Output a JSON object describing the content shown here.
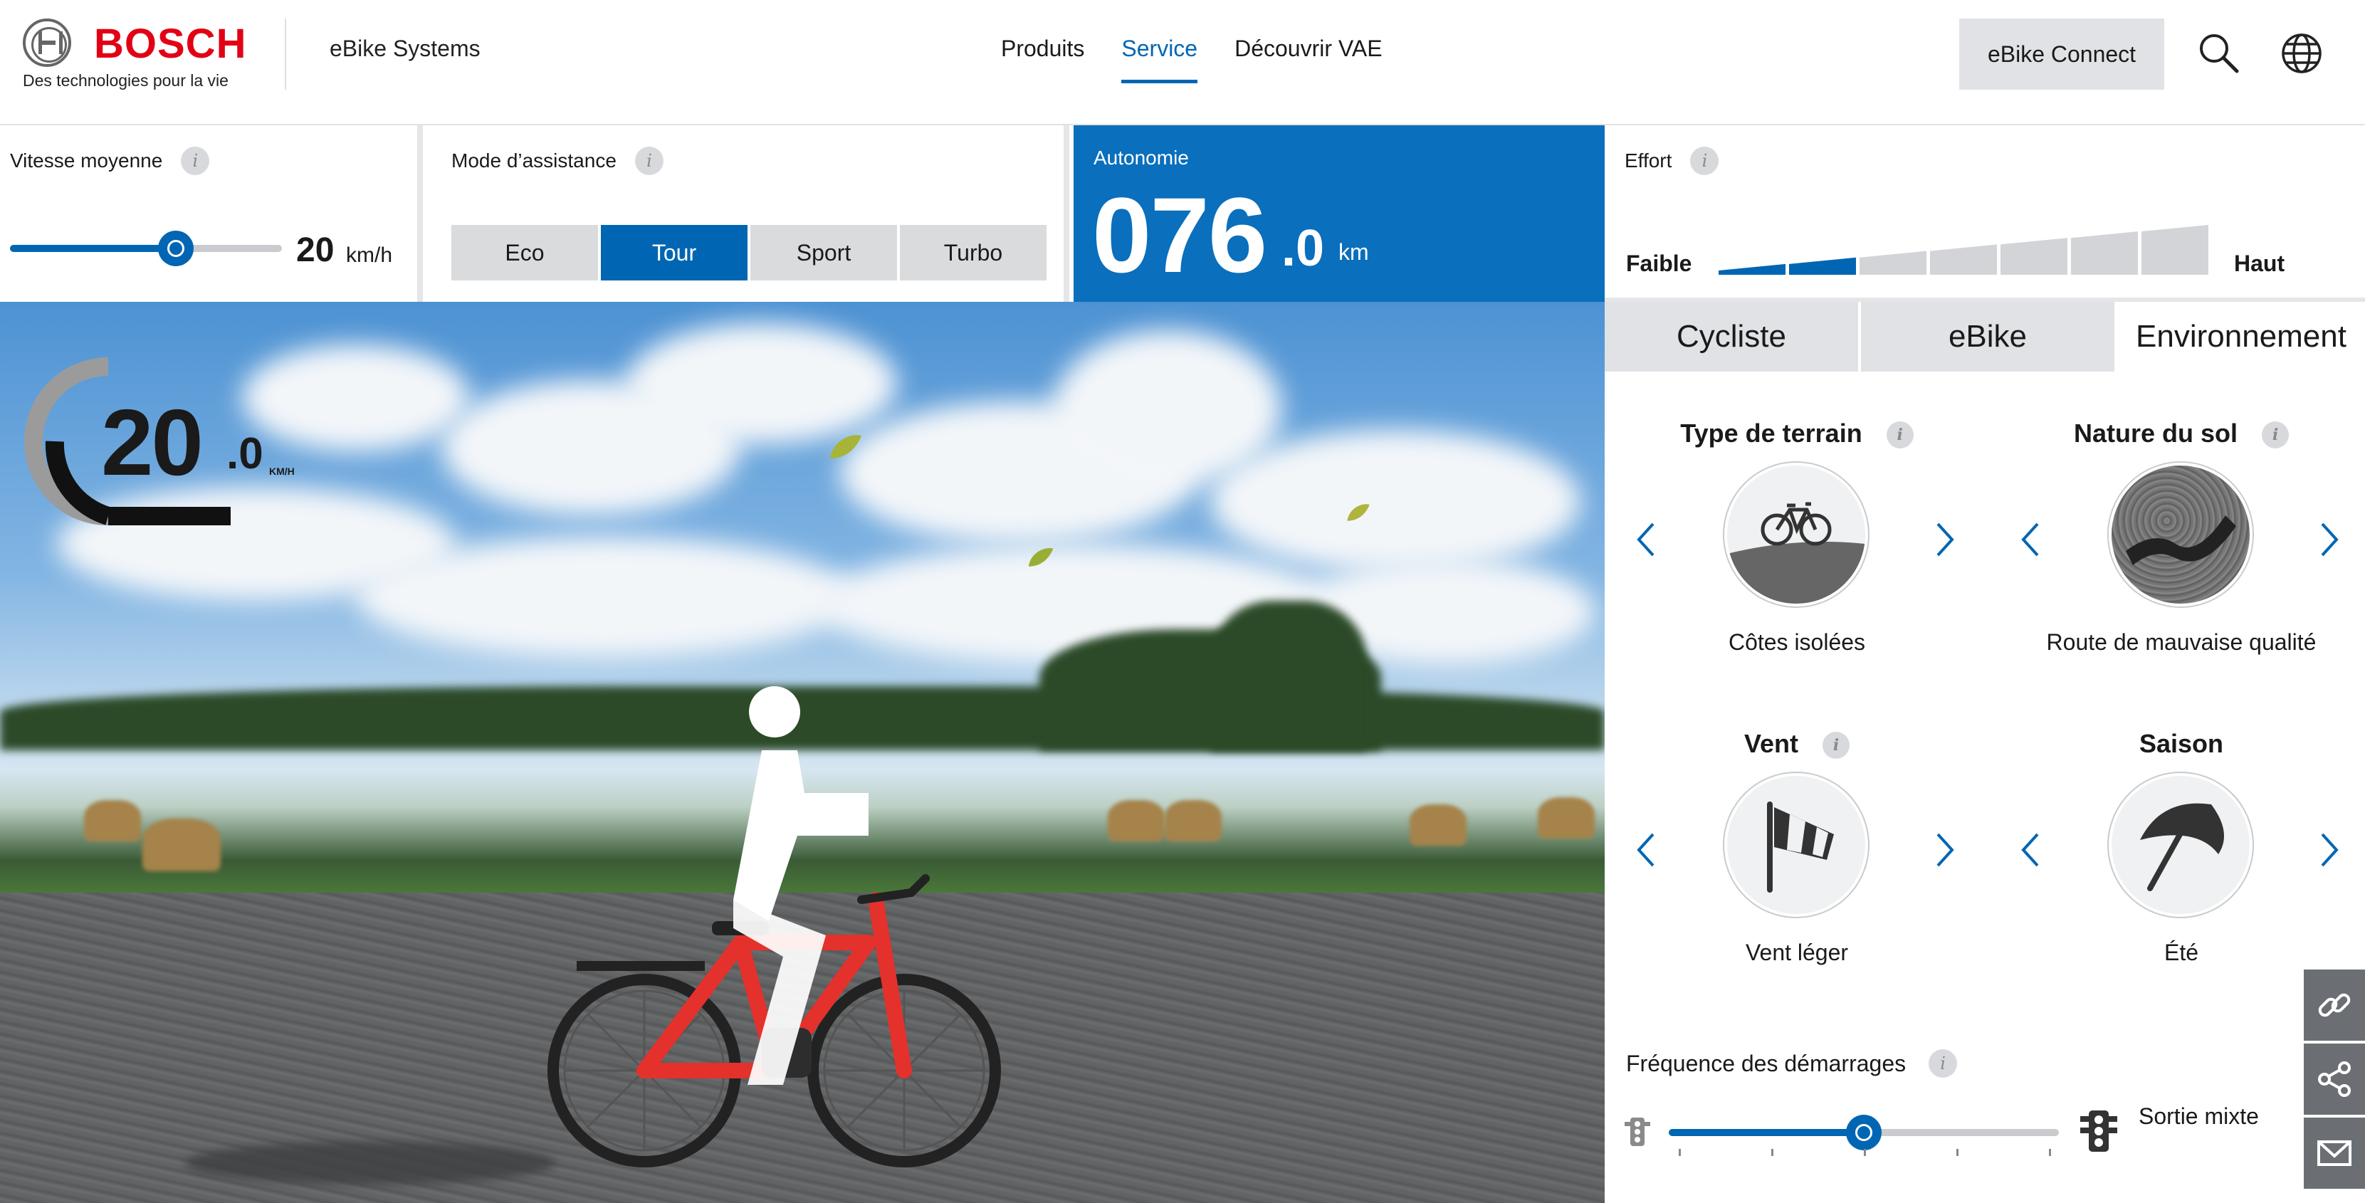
{
  "header": {
    "brand": "BOSCH",
    "tagline": "Des technologies pour la vie",
    "sub_brand": "eBike Systems",
    "nav": [
      {
        "label": "Produits",
        "active": false
      },
      {
        "label": "Service",
        "active": true
      },
      {
        "label": "Découvrir VAE",
        "active": false
      }
    ],
    "connect_label": "eBike Connect",
    "icons": [
      "search-icon",
      "globe-icon"
    ]
  },
  "speed_panel": {
    "title": "Vitesse moyenne",
    "value": "20",
    "unit": "km/h",
    "slider_fraction": 0.61
  },
  "mode_panel": {
    "title": "Mode d’assistance",
    "modes": [
      {
        "label": "Eco",
        "active": false
      },
      {
        "label": "Tour",
        "active": true
      },
      {
        "label": "Sport",
        "active": false
      },
      {
        "label": "Turbo",
        "active": false
      }
    ]
  },
  "range_panel": {
    "title": "Autonomie",
    "value_int": "076",
    "value_dec": ".0",
    "unit": "km"
  },
  "effort_panel": {
    "title": "Effort",
    "low_label": "Faible",
    "high_label": "Haut",
    "segments_total": 7,
    "segments_active": 2
  },
  "scene": {
    "speed_int": "20",
    "speed_dec": ".0",
    "speed_unit": "KM/H"
  },
  "tabs": [
    {
      "label": "Cycliste",
      "active": false
    },
    {
      "label": "eBike",
      "active": false
    },
    {
      "label": "Environnement",
      "active": true
    }
  ],
  "parameters": {
    "terrain": {
      "title": "Type de terrain",
      "value": "Côtes isolées",
      "icon": "bicycle-hill-icon"
    },
    "sol": {
      "title": "Nature du sol",
      "value": "Route de mauvaise qualité",
      "icon": "asphalt-icon"
    },
    "vent": {
      "title": "Vent",
      "value": "Vent léger",
      "icon": "windsock-icon"
    },
    "saison": {
      "title": "Saison",
      "value": "Été",
      "icon": "umbrella-icon"
    }
  },
  "frequency": {
    "title": "Fréquence des démarrages",
    "value": "Sortie mixte",
    "slider_fraction": 0.5,
    "ticks": 5
  },
  "share_dock": [
    "link-icon",
    "share-icon",
    "mail-icon"
  ],
  "colors": {
    "accent": "#0066b3",
    "brand_red": "#e20015",
    "range_bg": "#0a6fbc",
    "button_grey": "#d9dbdd"
  }
}
